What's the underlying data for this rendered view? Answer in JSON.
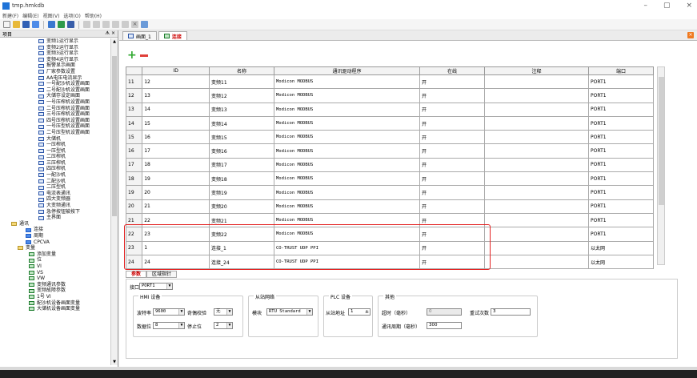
{
  "window": {
    "title": "tmp.hmkdb",
    "min": "–",
    "max": "▢",
    "close": "×"
  },
  "menu": [
    "新建(F)",
    "编辑(E)",
    "视图(V)",
    "选项(O)",
    "帮助(H)"
  ],
  "left_panel": {
    "title": "项目",
    "pin": "ᗑ ×"
  },
  "tree": [
    {
      "label": "变频1运行显示",
      "indent": 48,
      "icon": "screen"
    },
    {
      "label": "变频2运行显示",
      "indent": 48,
      "icon": "screen"
    },
    {
      "label": "变频3运行显示",
      "indent": 48,
      "icon": "screen"
    },
    {
      "label": "变频4运行显示",
      "indent": 48,
      "icon": "screen"
    },
    {
      "label": "报警显示画面",
      "indent": 48,
      "icon": "screen"
    },
    {
      "label": "厂家参数设置",
      "indent": 48,
      "icon": "screen"
    },
    {
      "label": "AA电压电流显示",
      "indent": 48,
      "icon": "screen"
    },
    {
      "label": "一号配沙机设置画面",
      "indent": 48,
      "icon": "screen"
    },
    {
      "label": "二号配沙机设置画面",
      "indent": 48,
      "icon": "screen"
    },
    {
      "label": "大储存设定画面",
      "indent": 48,
      "icon": "screen"
    },
    {
      "label": "一号压榨机设置画面",
      "indent": 48,
      "icon": "screen"
    },
    {
      "label": "二号压榨机设置画面",
      "indent": 48,
      "icon": "screen"
    },
    {
      "label": "三号压榨机设置画面",
      "indent": 48,
      "icon": "screen"
    },
    {
      "label": "四号压榨机设置画面",
      "indent": 48,
      "icon": "screen"
    },
    {
      "label": "一号压型机设置画面",
      "indent": 48,
      "icon": "screen"
    },
    {
      "label": "二号压型机设置画面",
      "indent": 48,
      "icon": "screen"
    },
    {
      "label": "大储机",
      "indent": 48,
      "icon": "screen"
    },
    {
      "label": "一压榨机",
      "indent": 48,
      "icon": "screen"
    },
    {
      "label": "一压型机",
      "indent": 48,
      "icon": "screen"
    },
    {
      "label": "二压榨机",
      "indent": 48,
      "icon": "screen"
    },
    {
      "label": "三压榨机",
      "indent": 48,
      "icon": "screen"
    },
    {
      "label": "四压榨机",
      "indent": 48,
      "icon": "screen"
    },
    {
      "label": "一配沙机",
      "indent": 48,
      "icon": "screen"
    },
    {
      "label": "二配沙机",
      "indent": 48,
      "icon": "screen"
    },
    {
      "label": "二压型机",
      "indent": 48,
      "icon": "screen"
    },
    {
      "label": "电流表通讯",
      "indent": 48,
      "icon": "screen"
    },
    {
      "label": "四大变频器",
      "indent": 48,
      "icon": "screen"
    },
    {
      "label": "大变频通讯",
      "indent": 48,
      "icon": "screen"
    },
    {
      "label": "急停按钮被按下",
      "indent": 48,
      "icon": "screen"
    },
    {
      "label": "主界面",
      "indent": 48,
      "icon": "screen"
    },
    {
      "label": "通讯",
      "indent": 14,
      "icon": "folder"
    },
    {
      "label": "连接",
      "indent": 32,
      "icon": "blue"
    },
    {
      "label": "周期",
      "indent": 32,
      "icon": "blue"
    },
    {
      "label": "CPCVA",
      "indent": 32,
      "icon": "blue"
    },
    {
      "label": "变量",
      "indent": 22,
      "icon": "folder"
    },
    {
      "label": "添加变量",
      "indent": 36,
      "icon": "ok"
    },
    {
      "label": "位",
      "indent": 36,
      "icon": "ok"
    },
    {
      "label": "VI",
      "indent": 36,
      "icon": "ok"
    },
    {
      "label": "VS",
      "indent": 36,
      "icon": "ok"
    },
    {
      "label": "VW",
      "indent": 36,
      "icon": "ok"
    },
    {
      "label": "变频通讯参数",
      "indent": 36,
      "icon": "ok"
    },
    {
      "label": "变频故障参数",
      "indent": 36,
      "icon": "ok"
    },
    {
      "label": "1号 VI",
      "indent": 36,
      "icon": "ok"
    },
    {
      "label": "配沙机设备画面变量",
      "indent": 36,
      "icon": "ok"
    },
    {
      "label": "大储机设备画面变量",
      "indent": 36,
      "icon": "ok"
    }
  ],
  "tabs": [
    {
      "label": "画面_1",
      "active": false
    },
    {
      "label": "连接",
      "active": true
    }
  ],
  "table": {
    "headers": [
      "",
      "ID",
      "名称",
      "通讯驱动程序",
      "在线",
      "注释",
      "端口"
    ],
    "rows": [
      {
        "rn": "11",
        "id": "12",
        "name": "变频11",
        "driver": "Modicon MODBUS",
        "online": "开",
        "note": "",
        "port": "PORT1"
      },
      {
        "rn": "12",
        "id": "13",
        "name": "变频12",
        "driver": "Modicon MODBUS",
        "online": "开",
        "note": "",
        "port": "PORT1"
      },
      {
        "rn": "13",
        "id": "14",
        "name": "变频13",
        "driver": "Modicon MODBUS",
        "online": "开",
        "note": "",
        "port": "PORT1"
      },
      {
        "rn": "14",
        "id": "15",
        "name": "变频14",
        "driver": "Modicon MODBUS",
        "online": "开",
        "note": "",
        "port": "PORT1"
      },
      {
        "rn": "15",
        "id": "16",
        "name": "变频15",
        "driver": "Modicon MODBUS",
        "online": "开",
        "note": "",
        "port": "PORT1"
      },
      {
        "rn": "16",
        "id": "17",
        "name": "变频16",
        "driver": "Modicon MODBUS",
        "online": "开",
        "note": "",
        "port": "PORT1"
      },
      {
        "rn": "17",
        "id": "18",
        "name": "变频17",
        "driver": "Modicon MODBUS",
        "online": "开",
        "note": "",
        "port": "PORT1"
      },
      {
        "rn": "18",
        "id": "19",
        "name": "变频18",
        "driver": "Modicon MODBUS",
        "online": "开",
        "note": "",
        "port": "PORT1"
      },
      {
        "rn": "19",
        "id": "20",
        "name": "变频19",
        "driver": "Modicon MODBUS",
        "online": "开",
        "note": "",
        "port": "PORT1"
      },
      {
        "rn": "20",
        "id": "21",
        "name": "变频20",
        "driver": "Modicon MODBUS",
        "online": "开",
        "note": "",
        "port": "PORT1"
      },
      {
        "rn": "21",
        "id": "22",
        "name": "变频21",
        "driver": "Modicon MODBUS",
        "online": "开",
        "note": "",
        "port": "PORT1"
      },
      {
        "rn": "22",
        "id": "23",
        "name": "变频22",
        "driver": "Modicon MODBUS",
        "online": "开",
        "note": "",
        "port": "PORT1"
      },
      {
        "rn": "23",
        "id": "1",
        "name": "连接_1",
        "driver": "CO-TRUST UDP PPI",
        "online": "开",
        "note": "",
        "port": "以太网"
      },
      {
        "rn": "24",
        "id": "24",
        "name": "连接_24",
        "driver": "CO-TRUST UDP PPI",
        "online": "开",
        "note": "",
        "port": "以太网"
      }
    ]
  },
  "bottom_tabs": [
    "参数",
    "区域指针"
  ],
  "props": {
    "port_label": "接口",
    "port_value": "PORT1",
    "hmi_group": "HMI 设备",
    "baud_label": "波特率",
    "baud_value": "9600",
    "parity_label": "奇偶校验",
    "parity_value": "无",
    "databits_label": "数据位",
    "databits_value": "8",
    "stopbits_label": "停止位",
    "stopbits_value": "2",
    "slave_group": "从站网络",
    "model_label": "模块",
    "model_value": "RTU Standard",
    "plc_group": "PLC 设备",
    "slave_addr_label": "从站地址",
    "slave_addr_value": "1",
    "other_group": "其他",
    "timeout_label": "超时（毫秒）",
    "timeout_value": "0",
    "retry_label": "重试次数",
    "retry_value": "3",
    "period_label": "通讯周期（毫秒）",
    "period_value": "300"
  }
}
